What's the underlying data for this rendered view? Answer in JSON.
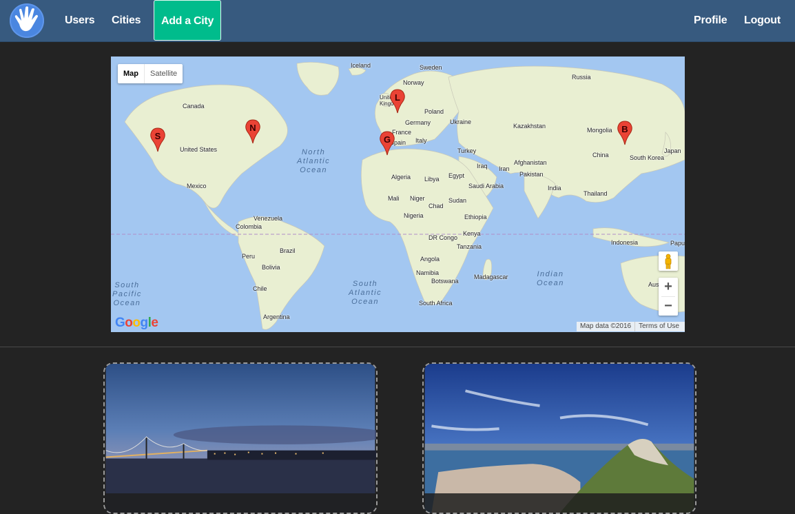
{
  "navbar": {
    "logo_icon": "hand-icon",
    "left_links": [
      "Users",
      "Cities"
    ],
    "add_button": "Add a City",
    "right_links": [
      "Profile",
      "Logout"
    ],
    "colors": {
      "bar": "#375a7f",
      "add_button": "#00bc8c"
    }
  },
  "map": {
    "type_controls": {
      "map": "Map",
      "satellite": "Satellite",
      "selected": "Map"
    },
    "country_labels": [
      "Iceland",
      "Sweden",
      "Norway",
      "Russia",
      "Canada",
      "United Kingdom",
      "Poland",
      "Germany",
      "Ukraine",
      "Kazakhstan",
      "France",
      "Mongolia",
      "Italy",
      "Spain",
      "Turkey",
      "Japan",
      "China",
      "South Korea",
      "United States",
      "Iraq",
      "Iran",
      "Afghanistan",
      "Pakistan",
      "Mexico",
      "Algeria",
      "Libya",
      "Egypt",
      "Saudi Arabia",
      "India",
      "Thailand",
      "Mali",
      "Niger",
      "Sudan",
      "Chad",
      "Venezuela",
      "Colombia",
      "Nigeria",
      "Ethiopia",
      "DR Congo",
      "Kenya",
      "Tanzania",
      "Indonesia",
      "Papua",
      "Peru",
      "Brazil",
      "Bolivia",
      "Angola",
      "Namibia",
      "Botswana",
      "Madagascar",
      "Chile",
      "South Africa",
      "Argentina",
      "Australia"
    ],
    "ocean_labels": {
      "north_atlantic": [
        "North",
        "Atlantic",
        "Ocean"
      ],
      "south_atlantic": [
        "South",
        "Atlantic",
        "Ocean"
      ],
      "south_pacific": [
        "South",
        "Pacific",
        "Ocean"
      ],
      "indian": [
        "Indian",
        "Ocean"
      ]
    },
    "markers": [
      {
        "letter": "S",
        "city_pin": "marker-san-francisco"
      },
      {
        "letter": "N",
        "city_pin": "marker-new-york"
      },
      {
        "letter": "L",
        "city_pin": "marker-london"
      },
      {
        "letter": "G",
        "city_pin": "marker-gibraltar"
      },
      {
        "letter": "B",
        "city_pin": "marker-beijing"
      }
    ],
    "zoom_in": "+",
    "zoom_out": "−",
    "google_logo": "Google",
    "attribution": {
      "data": "Map data ©2016",
      "terms": "Terms of Use"
    },
    "colors": {
      "water": "#a3c7f1",
      "land": "#e8f0d0",
      "marker": "#ea4335"
    }
  },
  "cards": [
    {
      "image_icon": "bay-bridge-night-photo"
    },
    {
      "image_icon": "rock-of-gibraltar-photo"
    }
  ]
}
